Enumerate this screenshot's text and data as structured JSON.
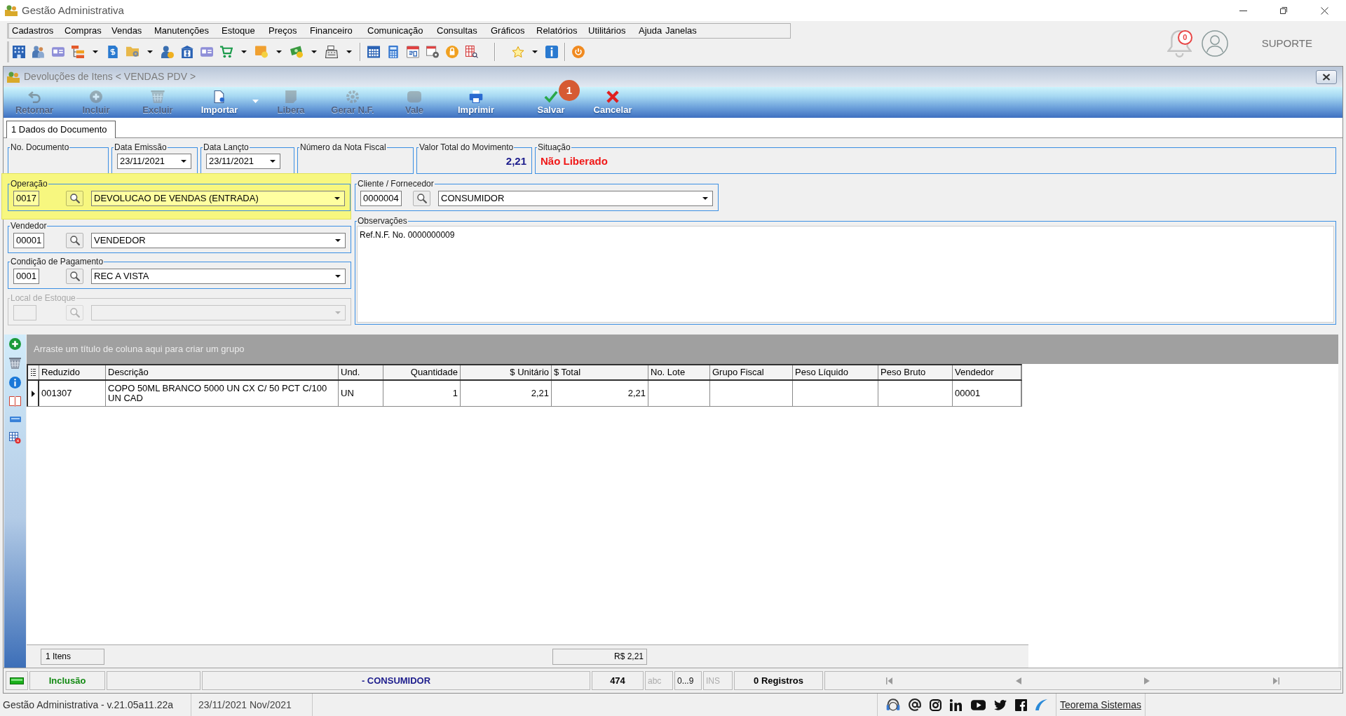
{
  "window": {
    "title": "Gestão Administrativa"
  },
  "menu": [
    "Cadastros",
    "Compras",
    "Vendas",
    "Manutenções",
    "Estoque",
    "Preços",
    "Financeiro",
    "Comunicação",
    "Consultas",
    "Gráficos",
    "Relatórios",
    "Utilitários",
    "Ajuda",
    "Janelas"
  ],
  "notifications": {
    "count": "0"
  },
  "user": {
    "name": "SUPORTE"
  },
  "document_window": {
    "title": "Devoluções de Itens < VENDAS PDV >",
    "actions": [
      {
        "label": "Retornar",
        "disabled": true
      },
      {
        "label": "Incluir",
        "disabled": true
      },
      {
        "label": "Excluir",
        "disabled": true
      },
      {
        "label": "Importar",
        "disabled": false,
        "has_menu": true
      },
      {
        "label": "Libera",
        "disabled": true
      },
      {
        "label": "Gerar N.F.",
        "disabled": true
      },
      {
        "label": "Vale",
        "disabled": true
      },
      {
        "label": "Imprimir",
        "disabled": false
      },
      {
        "label": "Salvar",
        "disabled": false,
        "badge": "1"
      },
      {
        "label": "Cancelar",
        "disabled": false
      }
    ],
    "tabs": [
      {
        "label": "1 Dados do Documento",
        "selected": true
      }
    ],
    "header_fields": [
      {
        "label": "No. Documento",
        "kind": "blank"
      },
      {
        "label": "Data Emissão",
        "kind": "date",
        "value": "23/11/2021"
      },
      {
        "label": "Data Lançto",
        "kind": "date",
        "value": "23/11/2021"
      },
      {
        "label": "Número da Nota Fiscal",
        "kind": "blank"
      },
      {
        "label": "Valor Total do Movimento",
        "kind": "amount",
        "value": "2,21"
      },
      {
        "label": "Situação",
        "kind": "status",
        "value": "Não Liberado"
      }
    ],
    "operation": {
      "label": "Operação",
      "code": "0017",
      "value": "DEVOLUCAO DE VENDAS (ENTRADA)",
      "highlighted": true
    },
    "client": {
      "label": "Cliente / Fornecedor",
      "code": "0000004",
      "value": "CONSUMIDOR"
    },
    "seller": {
      "label": "Vendedor",
      "code": "00001",
      "value": "VENDEDOR"
    },
    "payment_terms": {
      "label": "Condição de Pagamento",
      "code": "0001",
      "value": "REC A VISTA"
    },
    "stock_location": {
      "label": "Local de Estoque",
      "disabled": true
    },
    "observations": {
      "label": "Observações",
      "text": "Ref.N.F. No. 0000000009"
    },
    "grid": {
      "group_hint": "Arraste um título de coluna aqui para criar um grupo",
      "columns": [
        "Reduzido",
        "Descrição",
        "Und.",
        "Quantidade",
        "$ Unitário",
        "$ Total",
        "No. Lote",
        "Grupo Fiscal",
        "Peso Líquido",
        "Peso Bruto",
        "Vendedor"
      ],
      "rows": [
        {
          "selected": true,
          "cells": [
            "001307",
            "COPO 50ML BRANCO 5000 UN CX C/ 50 PCT C/100 UN CAD",
            "UN",
            "1",
            "2,21",
            "2,21",
            null,
            null,
            null,
            null,
            "00001"
          ]
        }
      ],
      "footer": {
        "item_count": "1 Itens",
        "total": "R$ 2,21"
      }
    },
    "status_bar": {
      "mode": "Inclusão",
      "record": "- CONSUMIDOR",
      "code": "474",
      "indicators": [
        {
          "label": "abc",
          "on": false
        },
        {
          "label": "0...9",
          "on": true
        },
        {
          "label": "INS",
          "on": false
        }
      ],
      "records": "0 Registros"
    }
  },
  "app_status": {
    "version": "Gestão Administrativa - v.21.05a11.22a",
    "period": "23/11/2021 Nov/2021",
    "link": "Teorema Sistemas"
  }
}
